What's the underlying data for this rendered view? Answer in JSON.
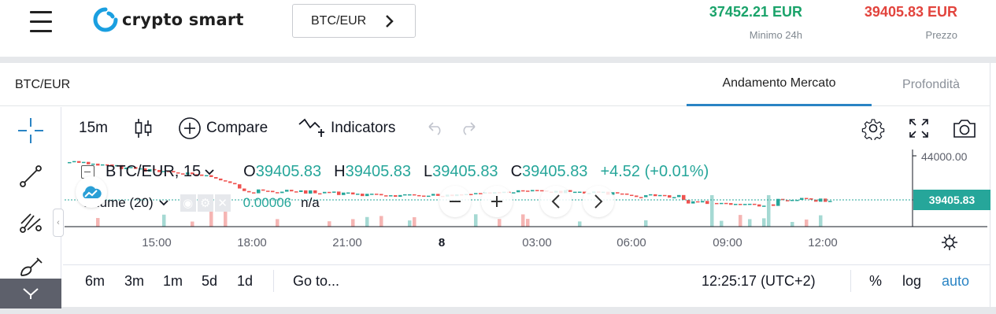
{
  "header": {
    "brand": "crypto smart",
    "pair_button": "BTC/EUR",
    "stats": [
      {
        "value": "37452.21 EUR",
        "caption": "Minimo 24h",
        "color": "#1aa36a"
      },
      {
        "value": "39405.83 EUR",
        "caption": "Prezzo",
        "color": "#e2443d"
      }
    ]
  },
  "panel": {
    "title": "BTC/EUR",
    "tabs": [
      {
        "label": "Andamento Mercato",
        "active": true
      },
      {
        "label": "Profondità",
        "active": false
      }
    ]
  },
  "chart_toolbar": {
    "interval": "15m",
    "compare": "Compare",
    "indicators": "Indicators",
    "icons": [
      "candles-icon",
      "plus-circle-icon",
      "indicators-icon",
      "undo-icon",
      "redo-icon",
      "settings-gear-icon",
      "fullscreen-icon",
      "camera-icon"
    ]
  },
  "left_toolbar": {
    "icons": [
      "crosshair-icon",
      "trend-line-icon",
      "pitchfork-icon",
      "brush-icon",
      "more-tools-icon"
    ]
  },
  "legend": {
    "symbol": "BTC/EUR, 15",
    "o_key": "O",
    "o_val": "39405.83",
    "h_key": "H",
    "h_val": "39405.83",
    "l_key": "L",
    "l_val": "39405.83",
    "c_key": "C",
    "c_val": "39405.83",
    "change": "+4.52 (+0.01%)",
    "volume_label": "Volume (20)",
    "volume_value": "0.00006",
    "volume_na": "n/a"
  },
  "chart_data": {
    "type": "candlestick",
    "price_axis_top": "44000.00",
    "last_price_label": "39405.83",
    "time_labels": [
      "15:00",
      "18:00",
      "21:00",
      "8",
      "03:00",
      "06:00",
      "09:00",
      "12:00"
    ],
    "colors": {
      "up": "#26a69a",
      "down": "#ef5350",
      "last_price": "#26a69a"
    }
  },
  "bottom_toolbar": {
    "ranges": [
      "6m",
      "3m",
      "1m",
      "5d",
      "1d"
    ],
    "goto": "Go to...",
    "clock": "12:25:17 (UTC+2)",
    "percent": "%",
    "log": "log",
    "auto": "auto"
  }
}
